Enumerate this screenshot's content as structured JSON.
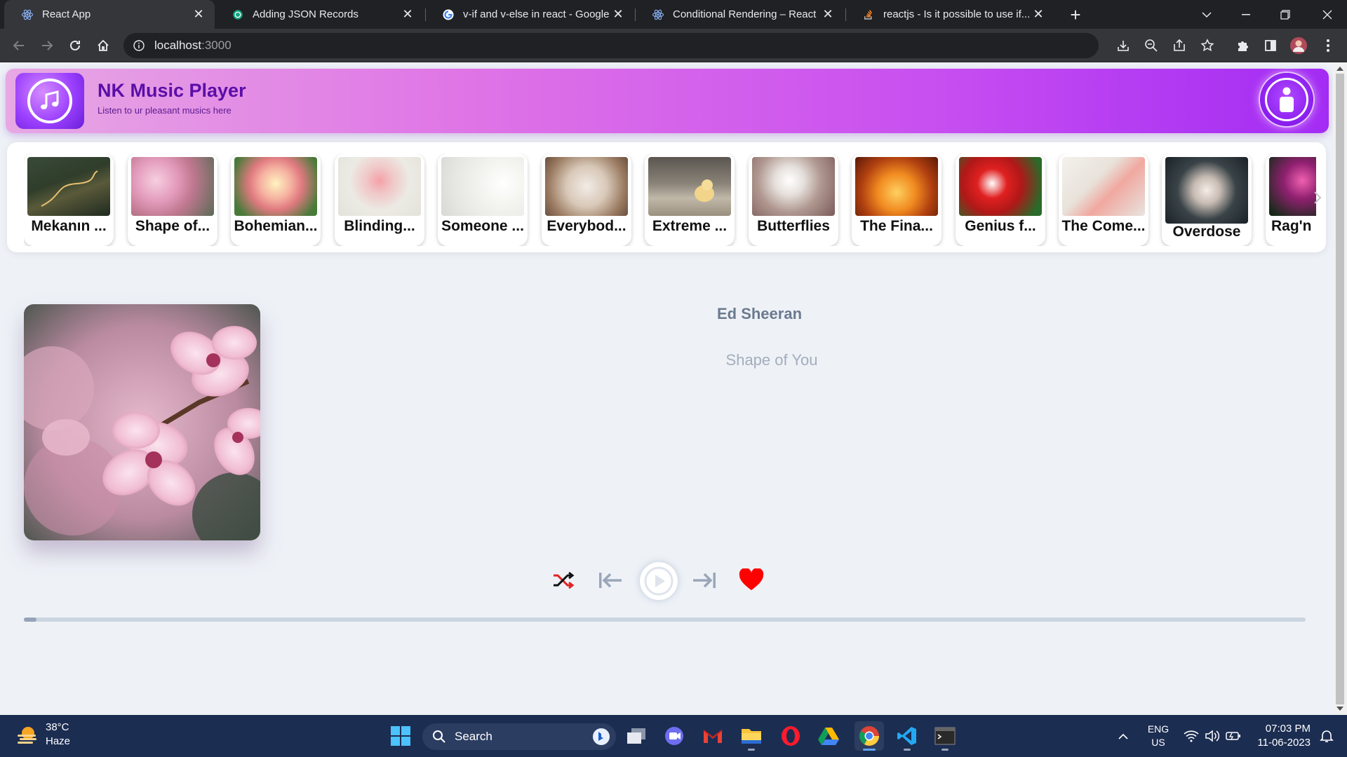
{
  "browser": {
    "tabs": [
      {
        "title": "React App",
        "icon": "react-icon",
        "active": true
      },
      {
        "title": "Adding JSON Records",
        "icon": "openai-icon",
        "active": false
      },
      {
        "title": "v-if and v-else in react - Google S",
        "icon": "google-icon",
        "active": false
      },
      {
        "title": "Conditional Rendering – React",
        "icon": "react-icon",
        "active": false
      },
      {
        "title": "reactjs - Is it possible to use if...el",
        "icon": "stackoverflow-icon",
        "active": false
      }
    ],
    "url_host": "localhost",
    "url_port": ":3000"
  },
  "app": {
    "title": "NK Music Player",
    "subtitle": "Listen to ur pleasant musics here",
    "accent": "#a32cf4"
  },
  "carousel": {
    "songs": [
      {
        "label": "Mekanın ...",
        "thumb": "road-landscape"
      },
      {
        "label": "Shape of...",
        "thumb": "pink-blossom"
      },
      {
        "label": "Bohemian...",
        "thumb": "lily-flower"
      },
      {
        "label": "Blinding...",
        "thumb": "pink-lily"
      },
      {
        "label": "Someone ...",
        "thumb": "white-blossom"
      },
      {
        "label": "Everybod...",
        "thumb": "branches"
      },
      {
        "label": "Extreme ...",
        "thumb": "chick"
      },
      {
        "label": "Butterflies",
        "thumb": "white-flower"
      },
      {
        "label": "The Fina...",
        "thumb": "orange-flowers"
      },
      {
        "label": "Genius f...",
        "thumb": "red-amaryllis"
      },
      {
        "label": "The Come...",
        "thumb": "flower-sketch"
      },
      {
        "label": "Overdose",
        "thumb": "white-roses"
      },
      {
        "label": "Rag'n",
        "thumb": "water-lily"
      }
    ]
  },
  "now_playing": {
    "artist": "Ed Sheeran",
    "title": "Shape of You",
    "progress": 0.01,
    "liked": true
  },
  "taskbar": {
    "weather_temp": "38°C",
    "weather_cond": "Haze",
    "search_label": "Search",
    "lang_top": "ENG",
    "lang_bottom": "US",
    "time": "07:03 PM",
    "date": "11-06-2023"
  }
}
